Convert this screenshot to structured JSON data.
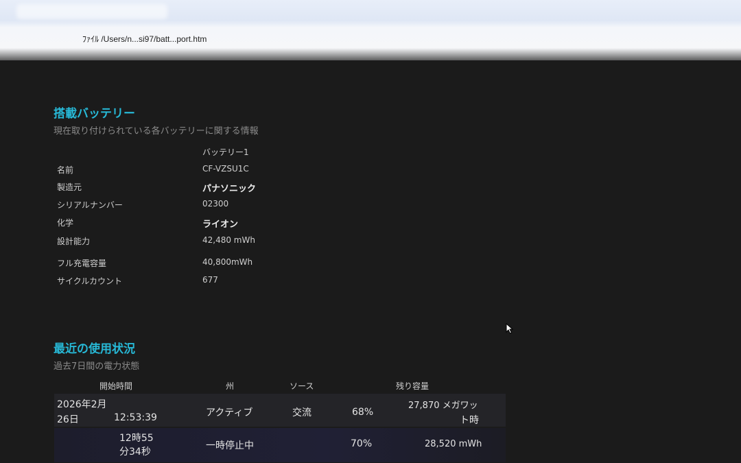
{
  "browser": {
    "address": "ﾌｧｲﾙ  /Users/n...si97/batt...port.htm"
  },
  "installed": {
    "title": "搭載バッテリー",
    "subtitle": "現在取り付けられている各バッテリーに関する情報",
    "column_header": "バッテリー1",
    "rows": [
      {
        "label": "名前",
        "value": "CF-VZSU1C"
      },
      {
        "label": "製造元",
        "value": "パナソニック"
      },
      {
        "label": "シリアルナンバー",
        "value": "02300"
      },
      {
        "label": "化学",
        "value": "ライオン"
      },
      {
        "label": "設計能力",
        "value": "42,480 mWh"
      },
      {
        "label": "フル充電容量",
        "value": "40,800mWh"
      },
      {
        "label": "サイクルカウント",
        "value": "677"
      }
    ]
  },
  "usage": {
    "title": "最近の使用状況",
    "subtitle": "過去7日間の電力状態",
    "headers": {
      "start": "開始時間",
      "state": "州",
      "source": "ソース",
      "remaining": "残り容量"
    },
    "rows": [
      {
        "date_line1": "2026年2月",
        "date_line2": "26日",
        "time": "12:53:39",
        "state": "アクティブ",
        "source": "交流",
        "percent": "68%",
        "capacity_a": "27,870 メガワッ",
        "capacity_b": "ト時"
      },
      {
        "time_line1": "12時55",
        "time_line2": "分34秒",
        "state": "一時停止中",
        "source": "",
        "percent": "70%",
        "capacity": "28,520 mWh"
      }
    ]
  }
}
